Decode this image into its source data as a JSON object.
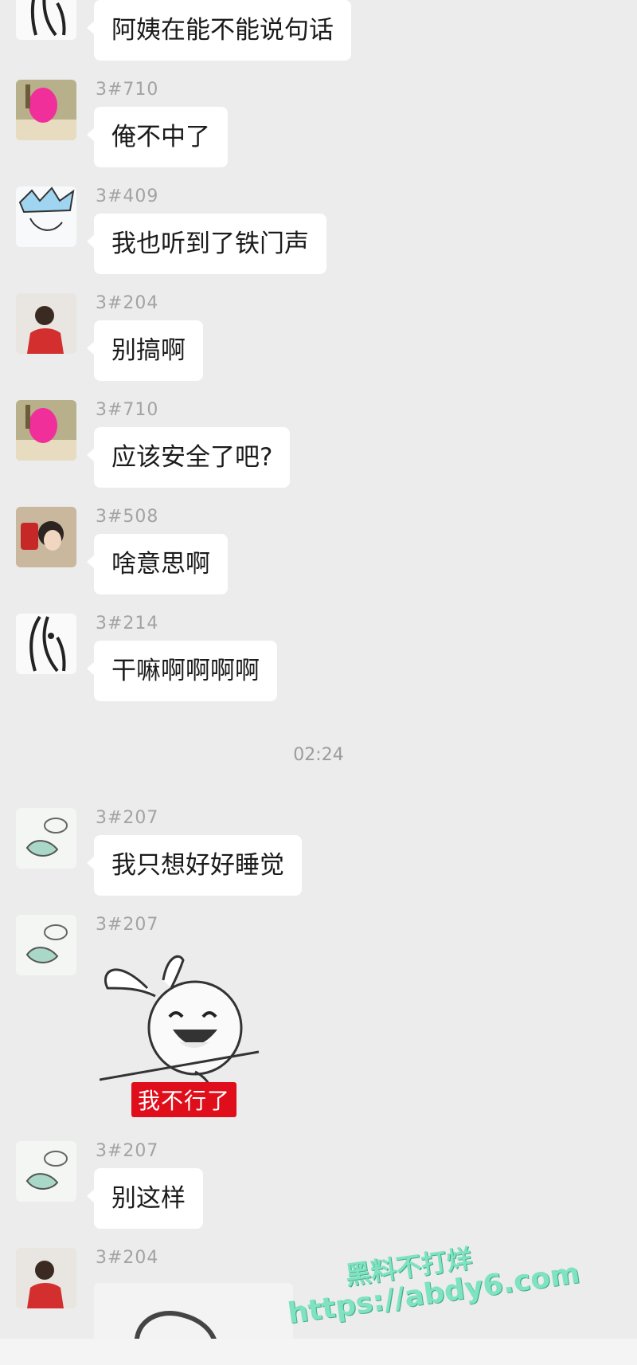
{
  "messages": [
    {
      "sender": "",
      "text": "阿姨在能不能说句话",
      "avatar": "ink-girl-avatar"
    },
    {
      "sender": "3#710",
      "text": "俺不中了",
      "avatar": "pink-mask-avatar"
    },
    {
      "sender": "3#409",
      "text": "我也听到了铁门声",
      "avatar": "anime-boy-avatar"
    },
    {
      "sender": "3#204",
      "text": "别搞啊",
      "avatar": "red-jacket-avatar"
    },
    {
      "sender": "3#710",
      "text": "应该安全了吧?",
      "avatar": "pink-mask-avatar"
    },
    {
      "sender": "3#508",
      "text": "啥意思啊",
      "avatar": "woman-photo-avatar"
    },
    {
      "sender": "3#214",
      "text": "干嘛啊啊啊啊",
      "avatar": "ink-girl-avatar"
    },
    {
      "sender": "3#207",
      "text": "我只想好好睡觉",
      "avatar": "sleep-sketch-avatar"
    },
    {
      "sender": "3#207",
      "text": "",
      "avatar": "sleep-sketch-avatar"
    },
    {
      "sender": "3#207",
      "text": "别这样",
      "avatar": "sleep-sketch-avatar"
    },
    {
      "sender": "3#204",
      "text": "",
      "avatar": "red-jacket-avatar"
    }
  ],
  "timestamp": "02:24",
  "sticker": {
    "caption": "我不行了",
    "icon": "laughing-rabbit-sticker"
  },
  "watermark": {
    "line1": "黑料不打烊",
    "line2": "https://abdy6.com"
  },
  "colors": {
    "bubble": "#ffffff",
    "background": "#ececec",
    "sender": "#a3a3a3",
    "watermark": "#7fe3c0",
    "caption_bg": "#e00d1b"
  }
}
